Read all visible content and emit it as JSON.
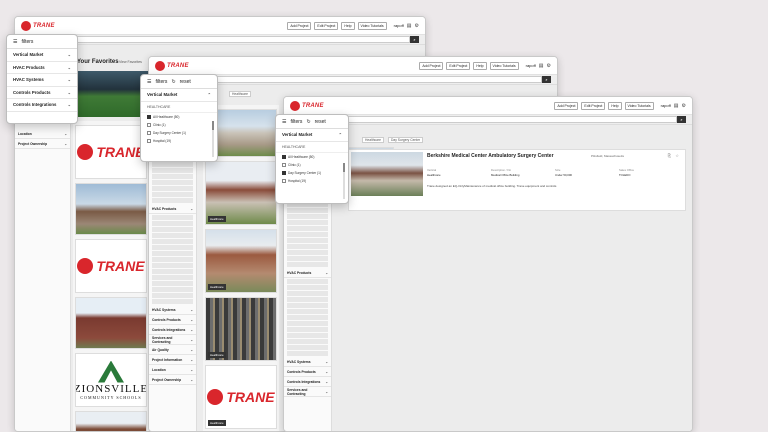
{
  "brand": {
    "logo_text": "TRANE",
    "red": "#d9262c"
  },
  "toolbar": {
    "add_project": "Add Project",
    "edit_project": "Edit Project",
    "help": "Help",
    "video_tutorials": "Video Tutorials",
    "user": "rapoff",
    "doc_icon": "document-icon",
    "gear_icon": "gear-icon"
  },
  "search": {
    "button_icon": "search-icon"
  },
  "filters": {
    "title": "filters",
    "reset": "reset",
    "sections": [
      "Vertical Market",
      "HVAC Products",
      "HVAC Systems",
      "Controls Products",
      "Controls Integrations"
    ],
    "healthcare_label": "HEALTHCARE",
    "options": [
      {
        "label": "All Healthcare (50)",
        "checked": true
      },
      {
        "label": "Clinic (1)",
        "checked": false
      },
      {
        "label": "Day Surgery Center (1)",
        "checked": true
      },
      {
        "label": "Hospital (19)",
        "checked": false
      }
    ]
  },
  "sidebar_back": {
    "items": [
      "Location",
      "Project Ownership"
    ]
  },
  "sidebar_mid": {
    "items": [
      "HVAC Products",
      "HVAC Systems",
      "Controls Products",
      "Controls Integrations",
      "Services and Contracting",
      "Air Quality",
      "Project Information",
      "Location",
      "Project Ownership"
    ]
  },
  "sidebar_front": {
    "items": [
      "HVAC Products",
      "HVAC Systems",
      "Controls Products",
      "Controls Integrations",
      "Services and Contracting"
    ]
  },
  "favorites": {
    "title": "Your Favorites",
    "link": "View Favorites"
  },
  "crumbs": {
    "mid": "Healthcare",
    "front": "Day Surgery Center"
  },
  "tags": {
    "healthcare": "Healthcare",
    "day_surgery": "Day Surgery Center"
  },
  "detail": {
    "title": "Berkshire Medical Center Ambulatory Surgery Center",
    "location": "Pittsfield, Massachusetts",
    "fields": [
      {
        "label": "Vertical",
        "value": "Healthcare"
      },
      {
        "label": "Description / Fin",
        "value": "Medical Office Building"
      },
      {
        "label": "Size",
        "value": "Under 50,000"
      },
      {
        "label": "Sales Office",
        "value": "TOLEDO"
      }
    ],
    "description": "Trane designed an EQ-OnlyMaintenance of medical office building. Trane equipment and controls"
  },
  "zionsville": {
    "name": "ZIONSVILLE",
    "sub": "COMMUNITY SCHOOLS"
  }
}
